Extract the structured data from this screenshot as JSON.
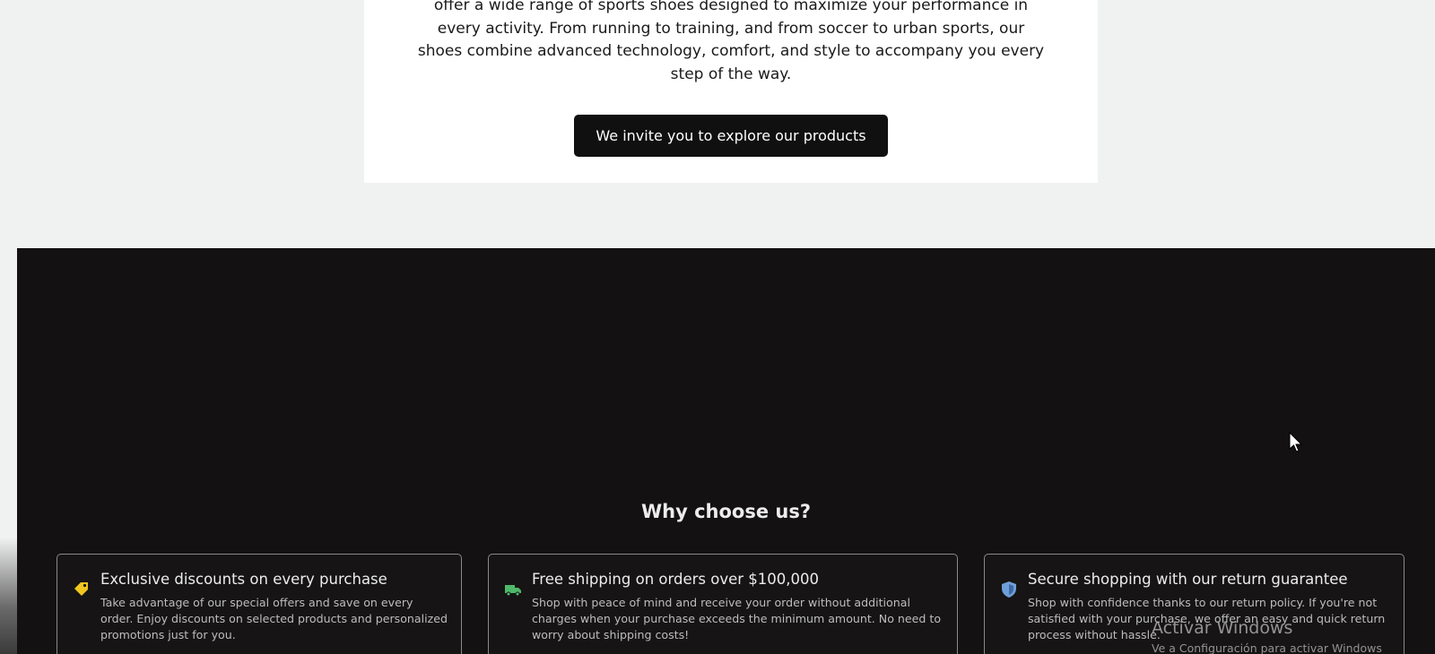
{
  "about": {
    "text": "offer a wide range of sports shoes designed to maximize your performance in every activity. From running to training, and from soccer to urban sports, our shoes combine advanced technology, comfort, and style to accompany you every step of the way.",
    "cta_label": "We invite you to explore our products"
  },
  "why": {
    "title": "Why choose us?",
    "cards": [
      {
        "icon": "tag-icon",
        "icon_color": "#f0c61f",
        "title": "Exclusive discounts on every purchase",
        "desc": "Take advantage of our special offers and save on every order. Enjoy discounts on selected products and personalized promotions just for you."
      },
      {
        "icon": "truck-icon",
        "icon_color": "#4fb86a",
        "title": "Free shipping on orders over $100,000",
        "desc": "Shop with peace of mind and receive your order without additional charges when your purchase exceeds the minimum amount. No need to worry about shipping costs!"
      },
      {
        "icon": "shield-icon",
        "icon_color": "#6f9fd8",
        "title": "Secure shopping with our return guarantee",
        "desc": "Shop with confidence thanks to our return policy. If you're not satisfied with your purchase, we offer an easy and quick return process without hassle."
      }
    ]
  },
  "watermark": {
    "title": "Activar Windows",
    "subtitle": "Ve a Configuración para activar Windows"
  },
  "colors": {
    "dark_bg": "#131111",
    "cta_bg": "#101010",
    "page_bg": "#f0f1f1"
  }
}
